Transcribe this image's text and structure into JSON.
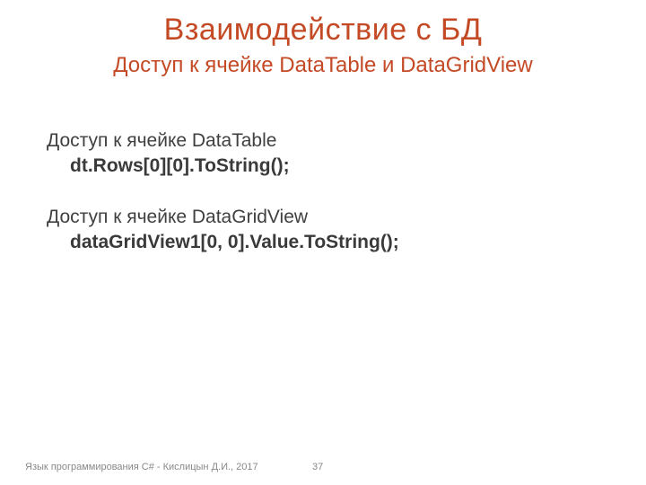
{
  "title": "Взаимодействие с БД",
  "subtitle": "Доступ к ячейке DataTable и DataGridView",
  "body": {
    "line1": "Доступ к ячейке DataTable",
    "code1": "dt.Rows[0][0].ToString();",
    "line2": "Доступ к ячейке DataGridView",
    "code2": "dataGridView1[0, 0].Value.ToString();"
  },
  "footer": {
    "credit": "Язык программирования C# - Кислицын Д.И., 2017",
    "page": "37"
  }
}
